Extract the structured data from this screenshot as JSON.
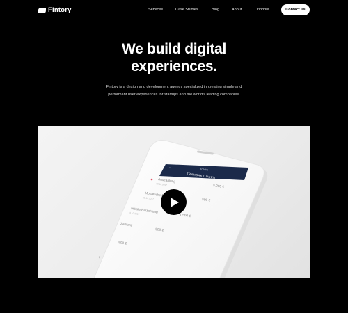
{
  "nav": {
    "logo_text": "Fintory",
    "items": [
      "Services",
      "Case Studies",
      "Blog",
      "About",
      "Dribbble"
    ],
    "contact_label": "Contact us"
  },
  "hero": {
    "title_line1": "We build digital",
    "title_line2": "experiences.",
    "subtitle": "Fintory is a design and development agency specialized in creating simple and performant user experiences for startups and the world's leading companies."
  },
  "phone": {
    "header_small": "KONTO",
    "header_title": "TRANSAKTIONEN",
    "rows": [
      {
        "label": "Auszahlung",
        "date": "28.10.2017",
        "amount": "5.000 €"
      },
      {
        "label": "Monatliche Rate",
        "date": "15.10.2017",
        "amount": "500 €"
      },
      {
        "label": "Initiale Einzahlung",
        "date": "3.10.2017",
        "amount": "1.500 €"
      },
      {
        "label": "Zahlung",
        "date": "",
        "amount": "500 €"
      },
      {
        "label": "",
        "date": "",
        "amount": "500 €"
      }
    ]
  },
  "colors": {
    "background": "#000000",
    "phone_header": "#1b2a4a",
    "accent_red": "#e0566a"
  }
}
